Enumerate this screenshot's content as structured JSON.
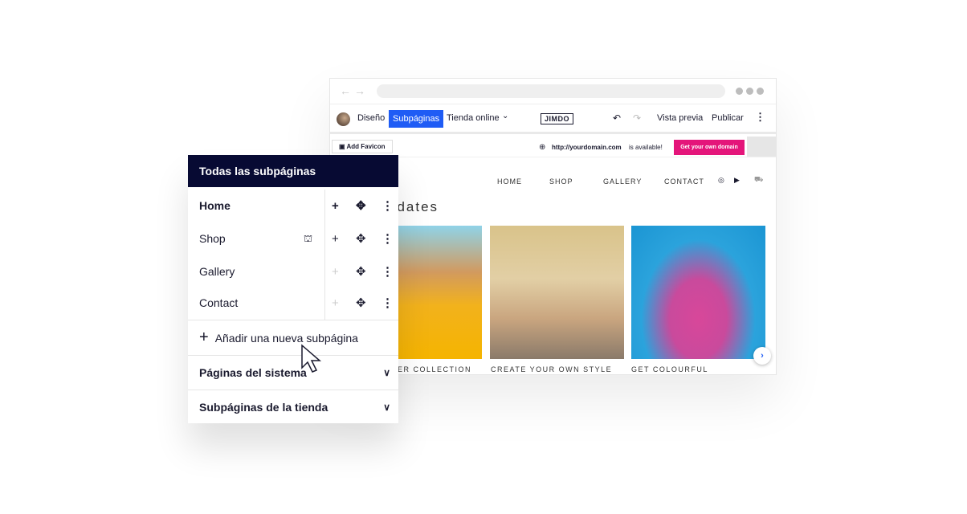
{
  "browser": {
    "back_icon": "arrow-left",
    "forward_icon": "arrow-right",
    "menu_icon": "three-dots"
  },
  "toolbar": {
    "design": "Diseño",
    "subpages": "Subpáginas",
    "store": "Tienda online",
    "logo": "JIMDO",
    "preview": "Vista previa",
    "publish": "Publicar",
    "accent": "#1f5cf5"
  },
  "favbar": {
    "add_favicon": "Add Favicon",
    "domain": "http://yourdomain.com",
    "available": "is available!",
    "get_domain": "Get your own domain",
    "cta_color": "#e4157a"
  },
  "site": {
    "nav": [
      "HOME",
      "SHOP",
      "GALLERY",
      "CONTACT"
    ],
    "heading": "odates",
    "captions": [
      "ER COLLECTION",
      "CREATE YOUR OWN STYLE",
      "GET COLOURFUL"
    ]
  },
  "panel": {
    "title": "Todas las subpáginas",
    "pages": [
      "Home",
      "Shop",
      "Gallery",
      "Contact"
    ],
    "add": "Añadir una nueva subpágina",
    "system": "Páginas del sistema",
    "store_pages": "Subpáginas de la tienda",
    "header_color": "#070a33"
  }
}
